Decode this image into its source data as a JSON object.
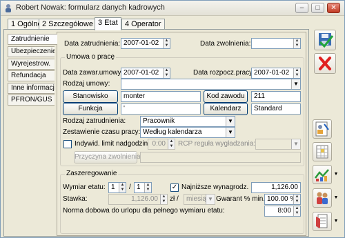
{
  "window": {
    "title": "Robert Nowak: formularz danych kadrowych",
    "minimize": "–",
    "maximize": "□",
    "close": "✕"
  },
  "tabs": [
    "1 Ogólne",
    "2 Szczegółowe",
    "3 Etat",
    "4 Operator"
  ],
  "side_tabs": [
    "Zatrudnienie",
    "Ubezpieczenie",
    "Wyrejestrow.",
    "Refundacja",
    "Inne informacje",
    "PFRON/GUS"
  ],
  "dates": {
    "hire_label": "Data zatrudnienia:",
    "hire_value": "2007-01-02",
    "leave_label": "Data zwolnienia:",
    "leave_value": ""
  },
  "contract": {
    "group_title": "Umowa o pracę",
    "contract_date_label": "Data zawar.umowy:",
    "contract_date_value": "2007-01-02",
    "start_date_label": "Data rozpocz.pracy:",
    "start_date_value": "2007-01-02",
    "type_label": "Rodzaj umowy:",
    "type_value": "",
    "position_button": "Stanowisko",
    "position_value": "monter",
    "code_button": "Kod zawodu",
    "code_value": "211",
    "function_button": "Funkcja",
    "function_value": "'",
    "calendar_button": "Kalendarz",
    "calendar_value": "Standard",
    "employment_type_label": "Rodzaj zatrudnienia:",
    "employment_type_value": "Pracownik",
    "schedule_label": "Zestawienie czasu pracy:",
    "schedule_value": "Według kalendarza",
    "overtime_check_label": "Indywid. limit nadgodzin",
    "overtime_value": "0:00",
    "rcp_label": "RCP reguła wygładzania:",
    "rcp_value": "",
    "reason_button": "Przyczyna zwolnienia",
    "reason_value": ""
  },
  "grading": {
    "group_title": "Zaszeregowanie",
    "fraction_label": "Wymiar etatu:",
    "fraction_num": "1",
    "fraction_sep": "/",
    "fraction_den": "1",
    "min_wage_label": "Najniższe wynagrodz.",
    "min_wage_checked": "✓",
    "min_wage_value": "1,126.00",
    "rate_label": "Stawka:",
    "rate_value": "1,126.00",
    "rate_unit": "zł /",
    "rate_period": "miesiąc",
    "guarantee_label": "Gwarant % min.:",
    "guarantee_value": "100.00 %",
    "leave_norm_label": "Norma dobowa do urlopu dla pełnego wymiaru etatu:",
    "leave_norm_value": "8:00"
  },
  "icons": {
    "save": "floppy-check-icon",
    "cancel": "red-x-icon"
  },
  "colors": {
    "accent": "#316ac5",
    "cancel": "#e02020",
    "window_bg": "#ece9d8"
  }
}
